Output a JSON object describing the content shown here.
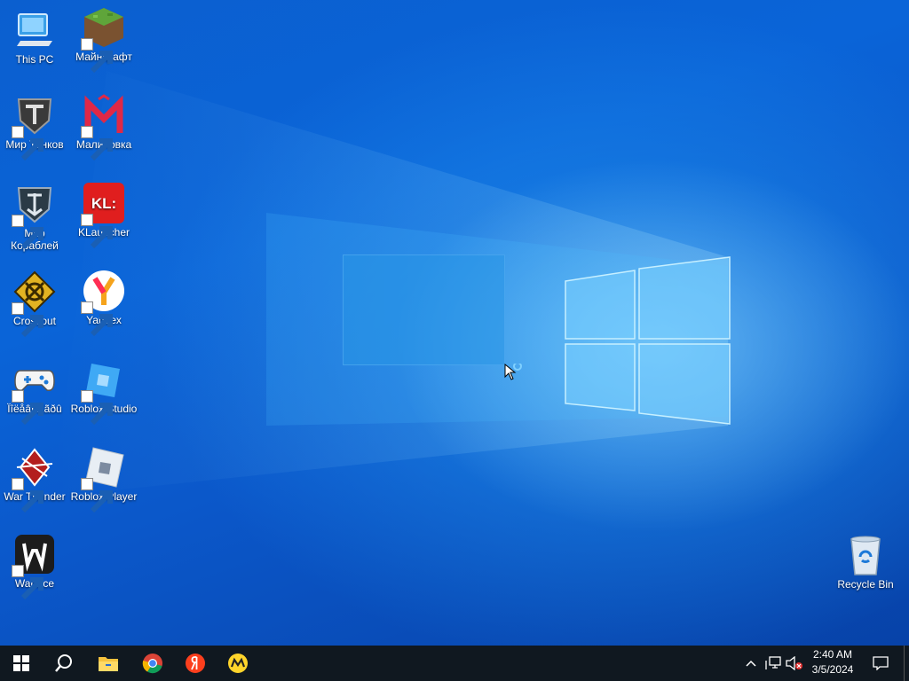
{
  "desktop_icons": [
    {
      "label": "This PC",
      "icon": "this-pc-icon"
    },
    {
      "label": "Майнкрафт",
      "icon": "minecraft-icon"
    },
    {
      "label": "Мир Танков",
      "icon": "mir-tankov-icon"
    },
    {
      "label": "Малиновка",
      "icon": "malinovka-icon"
    },
    {
      "label": "Мир Кораблей",
      "icon": "mir-korabley-icon"
    },
    {
      "label": "KLauncher",
      "icon": "klauncher-icon",
      "badge": "KL:"
    },
    {
      "label": "Crossout",
      "icon": "crossout-icon"
    },
    {
      "label": "Yandex",
      "icon": "yandex-browser-icon"
    },
    {
      "label": "Ïîëåâî Èãðû",
      "icon": "gamepad-icon"
    },
    {
      "label": "Roblox Studio",
      "icon": "roblox-studio-icon"
    },
    {
      "label": "War Thunder",
      "icon": "war-thunder-icon"
    },
    {
      "label": "Roblox Player",
      "icon": "roblox-player-icon"
    },
    {
      "label": "Warface",
      "icon": "warface-icon"
    },
    {
      "label": "Recycle Bin",
      "icon": "recycle-bin-icon"
    }
  ],
  "taskbar": {
    "items": [
      "start-icon",
      "search-icon",
      "file-explorer-icon",
      "chrome-icon",
      "yandex-icon",
      "yandex-market-icon"
    ],
    "tray": [
      "chevron-up-icon",
      "network-icon",
      "volume-muted-icon",
      "notification-icon"
    ],
    "clock": {
      "time": "2:40 AM",
      "date": "3/5/2024"
    }
  },
  "colors": {
    "desktop": "#0a64d8",
    "taskbar": "#101820",
    "accent": "#ffffff"
  }
}
